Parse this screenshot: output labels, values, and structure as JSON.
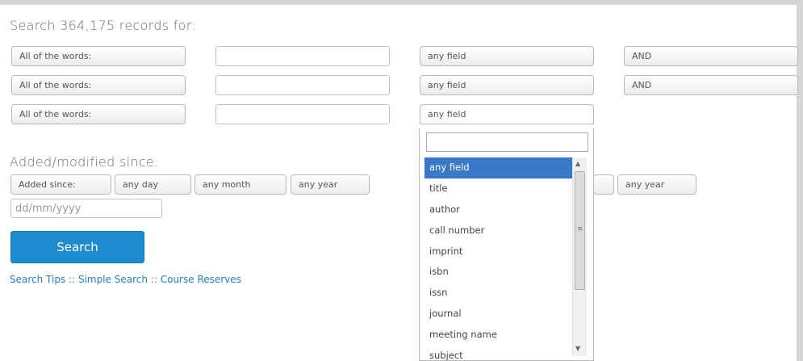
{
  "search_heading": "Search 364,175 records for:",
  "rows": [
    {
      "mode": "All of the words:",
      "value": "",
      "field": "any field",
      "bool": "AND"
    },
    {
      "mode": "All of the words:",
      "value": "",
      "field": "any field",
      "bool": "AND"
    },
    {
      "mode": "All of the words:",
      "value": "",
      "field": "any field"
    }
  ],
  "date_heading": "Added/modified since:",
  "date": {
    "since_label": "Added since:",
    "day": "any day",
    "month": "any month",
    "year": "any year",
    "year2": "any year",
    "placeholder": "dd/mm/yyyy"
  },
  "search_button": "Search",
  "links": {
    "tips": "Search Tips",
    "simple": "Simple Search",
    "reserves": "Course Reserves",
    "separator": "::"
  },
  "dropdown": {
    "filter_value": "",
    "selected": "any field",
    "options": [
      "any field",
      "title",
      "author",
      "call number",
      "imprint",
      "isbn",
      "issn",
      "journal",
      "meeting name",
      "subject"
    ],
    "colors": {
      "highlight": "#3a78c8",
      "button": "#1e8bce",
      "link": "#2a7bbd"
    }
  }
}
